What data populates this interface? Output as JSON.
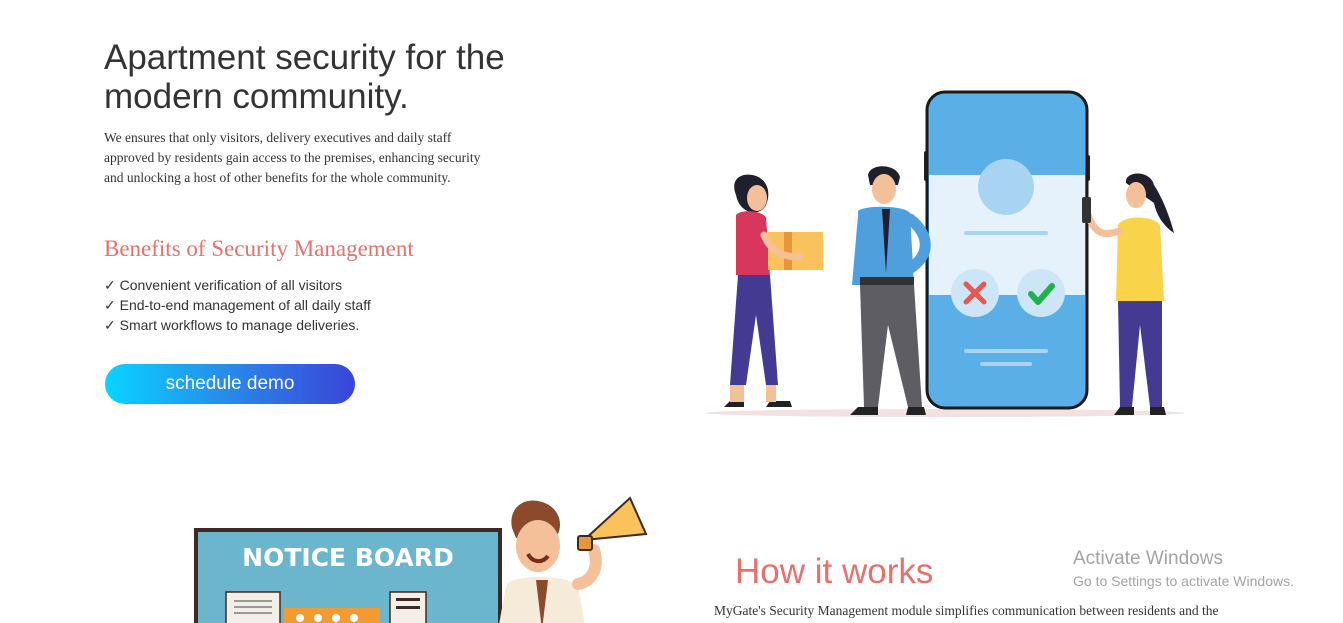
{
  "hero": {
    "title_line1": "Apartment security for the",
    "title_line2": "modern community.",
    "description_lines": [
      "We ensures that only visitors, delivery executives and daily staff",
      "approved by residents gain access to the premises, enhancing security",
      "and unlocking a host of other benefits for the whole community."
    ]
  },
  "benefits": {
    "title": "Benefits of Security Management",
    "items": [
      "✓ Convenient verification of all visitors",
      "✓ End-to-end management of all daily staff",
      "✓ Smart workflows to manage deliveries."
    ]
  },
  "cta": {
    "label": "schedule demo"
  },
  "notice_board": {
    "sign_text": "NOTICE BOARD"
  },
  "how_it_works": {
    "title": "How it works",
    "description": "MyGate's Security Management module simplifies communication between residents and the"
  },
  "watermark": {
    "title": "Activate Windows",
    "subtitle": "Go to Settings to activate Windows."
  },
  "colors": {
    "accent": "#e8706a",
    "button_start": "#08d4ff",
    "button_end": "#3a45d8",
    "phone_blue": "#5ab0e6"
  },
  "icons": [
    "check-icon",
    "reject-icon",
    "approve-icon",
    "megaphone-icon"
  ]
}
